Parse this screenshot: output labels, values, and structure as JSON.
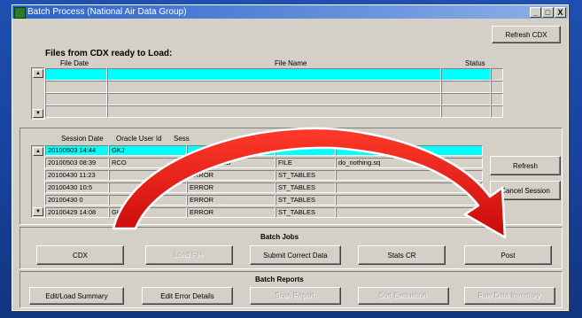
{
  "window": {
    "title": "Batch Process (National Air Data Group)",
    "controls": [
      "_",
      "□",
      "X"
    ]
  },
  "toolbar": {
    "refresh_cdx": "Refresh CDX"
  },
  "files": {
    "heading": "Files from CDX  ready to Load:",
    "columns": [
      "File Date",
      "File Name",
      "Status"
    ]
  },
  "sessions": {
    "columns": [
      "Session Date",
      "Oracle User Id",
      "Sess"
    ],
    "rows": [
      {
        "date": "20100503 14:44",
        "user": "GKJ",
        "status": "",
        "type": "",
        "proc": ""
      },
      {
        "date": "20100503 08:39",
        "user": "RCO",
        "status": "COMPLETED",
        "type": "FILE",
        "proc": "do_nothing.sq"
      },
      {
        "date": "20100430 11:23",
        "user": "",
        "status": "ERROR",
        "type": "ST_TABLES",
        "proc": ""
      },
      {
        "date": "20100430 10:5",
        "user": "",
        "status": "ERROR",
        "type": "ST_TABLES",
        "proc": ""
      },
      {
        "date": "20100430 0",
        "user": "",
        "status": "ERROR",
        "type": "ST_TABLES",
        "proc": ""
      },
      {
        "date": "20100429 14:08",
        "user": "GKJ",
        "status": "ERROR",
        "type": "ST_TABLES",
        "proc": ""
      }
    ],
    "refresh_label": "Refresh",
    "cancel_label": "Cancel Session"
  },
  "batch_jobs": {
    "title": "Batch Jobs",
    "buttons": [
      "CDX",
      "Load File",
      "Submit Correct Data",
      "Stats CR",
      "Post"
    ]
  },
  "batch_reports": {
    "title": "Batch Reports",
    "buttons": [
      "Edit/Load Summary",
      "Edit Error Details",
      "Scan Report",
      "Sort Evaluation",
      "Raw Data Inventory"
    ]
  },
  "colors": {
    "selection": "#00ffff",
    "arrow": "#e01010",
    "desktop": "#1f4fb0"
  }
}
